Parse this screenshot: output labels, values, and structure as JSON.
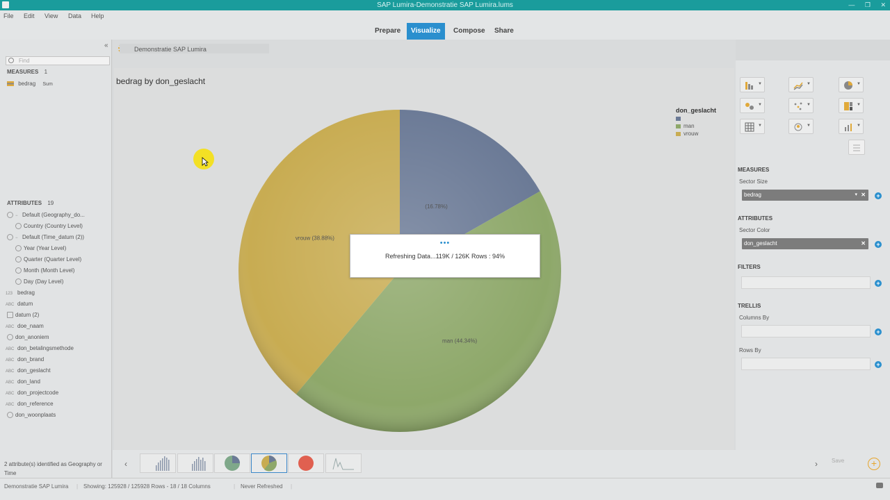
{
  "window": {
    "title": "SAP Lumira-Demonstratie SAP Lumira.lums"
  },
  "menu": {
    "file": "File",
    "edit": "Edit",
    "view": "View",
    "data": "Data",
    "help": "Help"
  },
  "modes": {
    "prepare": "Prepare",
    "visualize": "Visualize",
    "compose": "Compose",
    "share": "Share"
  },
  "dataset": {
    "name": "Demonstratie SAP Lumira"
  },
  "left": {
    "find_placeholder": "Find",
    "measures_header": "MEASURES",
    "measures_count": "1",
    "measures": [
      {
        "label": "bedrag",
        "agg": "Sum"
      }
    ],
    "attributes_header": "ATTRIBUTES",
    "attributes_count": "19",
    "attributes": [
      {
        "label": "Default (Geography_do...",
        "prefix": "−"
      },
      {
        "label": "Country (Country Level)",
        "prefix": ""
      },
      {
        "label": "Default (Time_datum (2))",
        "prefix": "−"
      },
      {
        "label": "Year (Year Level)",
        "prefix": ""
      },
      {
        "label": "Quarter (Quarter Level)",
        "prefix": ""
      },
      {
        "label": "Month (Month Level)",
        "prefix": ""
      },
      {
        "label": "Day (Day Level)",
        "prefix": ""
      },
      {
        "label": "bedrag",
        "prefix": "123"
      },
      {
        "label": "datum",
        "prefix": "ABC"
      },
      {
        "label": "datum (2)",
        "prefix": ""
      },
      {
        "label": "doe_naam",
        "prefix": "ABC"
      },
      {
        "label": "don_anoniem",
        "prefix": ""
      },
      {
        "label": "don_betalingsmethode",
        "prefix": "ABC"
      },
      {
        "label": "don_brand",
        "prefix": "ABC"
      },
      {
        "label": "don_geslacht",
        "prefix": "ABC"
      },
      {
        "label": "don_land",
        "prefix": "ABC"
      },
      {
        "label": "don_projectcode",
        "prefix": "ABC"
      },
      {
        "label": "don_reference",
        "prefix": "ABC"
      },
      {
        "label": "don_woonplaats",
        "prefix": ""
      }
    ],
    "geo_note": "2 attribute(s) identified as Geography or Time"
  },
  "chart": {
    "title": "bedrag by don_geslacht",
    "legend_title": "don_geslacht",
    "legend": [
      {
        "label": "",
        "color": "#6b7a96"
      },
      {
        "label": "man",
        "color": "#8ea86a"
      },
      {
        "label": "vrouw",
        "color": "#c8ac52"
      }
    ],
    "slice_labels": {
      "blank": "(16.78%)",
      "vrouw": "vrouw (38.88%)",
      "man": "man (44.34%)"
    }
  },
  "chart_data": {
    "type": "pie",
    "title": "bedrag by don_geslacht",
    "categories": [
      "",
      "man",
      "vrouw"
    ],
    "values": [
      16.78,
      44.34,
      38.88
    ],
    "unit": "%",
    "legend_title": "don_geslacht",
    "legend_position": "top-right"
  },
  "modal": {
    "message": "Refreshing Data...119K / 126K Rows : 94%"
  },
  "right": {
    "measures_header": "MEASURES",
    "sector_size_label": "Sector Size",
    "sector_size_value": "bedrag",
    "attributes_header": "ATTRIBUTES",
    "sector_color_label": "Sector Color",
    "sector_color_value": "don_geslacht",
    "filters_header": "FILTERS",
    "trellis_header": "TRELLIS",
    "columns_by_label": "Columns By",
    "rows_by_label": "Rows By"
  },
  "bottom": {
    "save_label": "Save"
  },
  "status": {
    "dataset": "Demonstratie SAP Lumira",
    "showing": "Showing: 125928 / 125928 Rows - 18 / 18 Columns",
    "refresh": "Never Refreshed"
  }
}
